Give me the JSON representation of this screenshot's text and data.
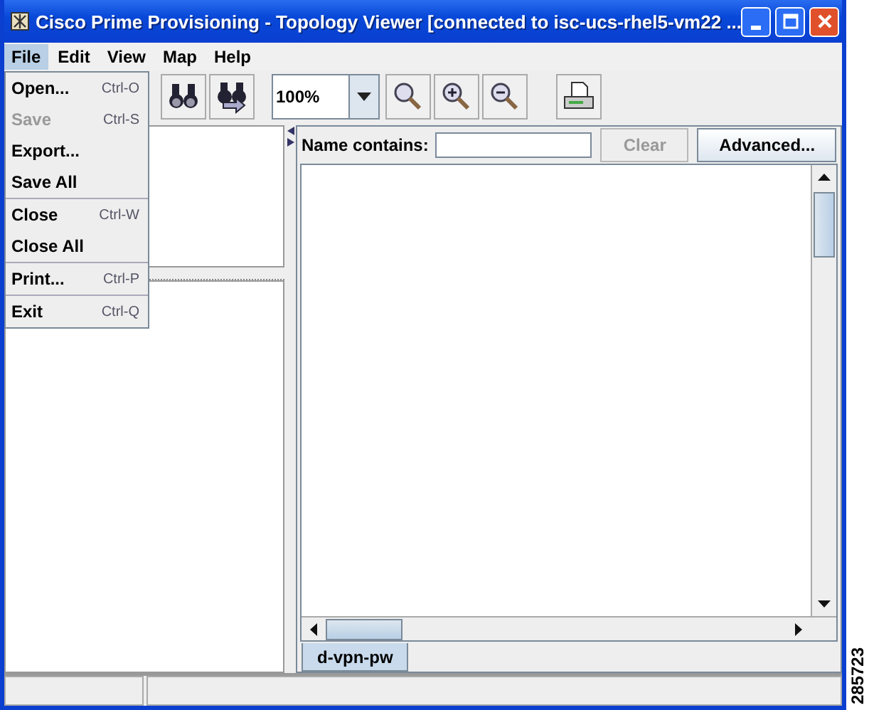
{
  "window": {
    "title": "Cisco Prime Provisioning - Topology Viewer [connected to isc-ucs-rhel5-vm22 ..."
  },
  "menu_bar": [
    {
      "label": "File",
      "selected": true
    },
    {
      "label": "Edit",
      "selected": false
    },
    {
      "label": "View",
      "selected": false
    },
    {
      "label": "Map",
      "selected": false
    },
    {
      "label": "Help",
      "selected": false
    }
  ],
  "file_menu": [
    [
      {
        "label": "Open...",
        "shortcut": "Ctrl-O",
        "disabled": false
      },
      {
        "label": "Save",
        "shortcut": "Ctrl-S",
        "disabled": true
      },
      {
        "label": "Export...",
        "disabled": false
      },
      {
        "label": "Save All",
        "disabled": false
      }
    ],
    [
      {
        "label": "Close",
        "shortcut": "Ctrl-W",
        "disabled": false
      },
      {
        "label": "Close All",
        "disabled": false
      }
    ],
    [
      {
        "label": "Print...",
        "shortcut": "Ctrl-P",
        "disabled": false
      }
    ],
    [
      {
        "label": "Exit",
        "shortcut": "Ctrl-Q",
        "disabled": false
      }
    ]
  ],
  "toolbar": [
    {
      "kind": "find"
    },
    {
      "kind": "find-next"
    },
    {
      "kind": "zoom-combo",
      "value": "100%"
    },
    {
      "kind": "zoom"
    },
    {
      "kind": "zoom-in"
    },
    {
      "kind": "zoom-out"
    },
    {
      "kind": "print"
    }
  ],
  "filter": {
    "label": "Name contains:",
    "buttons": [
      {
        "label": "Clear",
        "disabled": true
      },
      {
        "label": "Advanced...",
        "disabled": false
      }
    ]
  },
  "tabs": [
    {
      "label": "d-vpn-pw",
      "selected": true
    }
  ],
  "figure_number": "285723"
}
